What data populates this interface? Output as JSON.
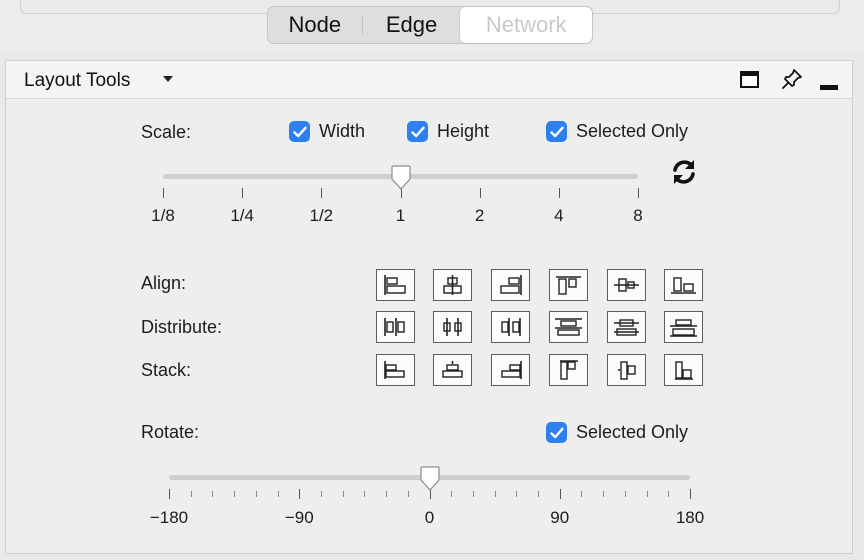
{
  "tabs": [
    {
      "label": "Node",
      "active": false
    },
    {
      "label": "Edge",
      "active": false
    },
    {
      "label": "Network",
      "active": true
    }
  ],
  "panel": {
    "title": "Layout Tools",
    "icons": [
      "maximize-icon",
      "pin-icon",
      "minimize-icon"
    ]
  },
  "scale": {
    "label": "Scale:",
    "checkboxes": [
      {
        "label": "Width",
        "checked": true
      },
      {
        "label": "Height",
        "checked": true
      },
      {
        "label": "Selected Only",
        "checked": true
      }
    ],
    "ticks": [
      "1/8",
      "1/4",
      "1/2",
      "1",
      "2",
      "4",
      "8"
    ],
    "value": "1",
    "refresh_icon": "refresh-icon"
  },
  "align": {
    "label": "Align:",
    "buttons": [
      "align-left",
      "align-center-horizontal",
      "align-right",
      "align-top",
      "align-center-vertical",
      "align-bottom"
    ]
  },
  "distribute": {
    "label": "Distribute:",
    "buttons": [
      "distribute-left",
      "distribute-center-horizontal",
      "distribute-right",
      "distribute-top",
      "distribute-center-vertical",
      "distribute-bottom"
    ]
  },
  "stack": {
    "label": "Stack:",
    "buttons": [
      "stack-left",
      "stack-center-horizontal",
      "stack-right",
      "stack-top",
      "stack-center-vertical",
      "stack-bottom"
    ]
  },
  "rotate": {
    "label": "Rotate:",
    "selected_only": {
      "label": "Selected Only",
      "checked": true
    },
    "ticks": [
      "−180",
      "−90",
      "0",
      "90",
      "180"
    ],
    "value": 0
  },
  "colors": {
    "checkbox": "#2f80ef",
    "active_tab_text": "#c9c9c9"
  }
}
